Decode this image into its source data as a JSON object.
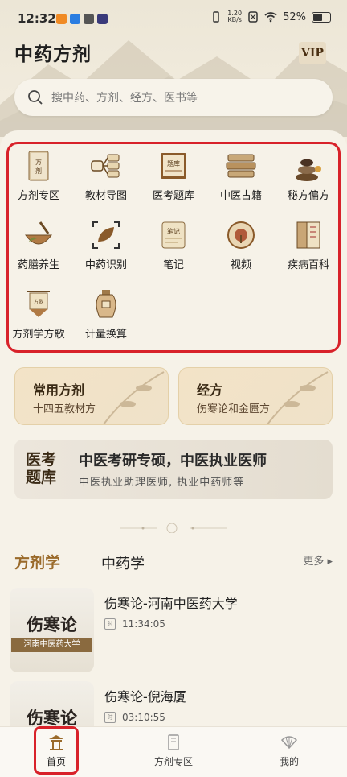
{
  "status_bar": {
    "time": "12:32",
    "net_speed": "1.20",
    "net_unit": "KB/s",
    "battery": "52%"
  },
  "header": {
    "title": "中药方剂",
    "vip_label": "VIP"
  },
  "search": {
    "placeholder": "搜中药、方剂、经方、医书等"
  },
  "grid": {
    "items": [
      {
        "label": "方剂专区",
        "icon": "prescription-book-icon"
      },
      {
        "label": "教材导图",
        "icon": "mind-map-icon"
      },
      {
        "label": "医考题库",
        "icon": "question-bank-icon"
      },
      {
        "label": "中医古籍",
        "icon": "ancient-books-icon"
      },
      {
        "label": "秘方偏方",
        "icon": "stones-icon"
      },
      {
        "label": "药膳养生",
        "icon": "herb-mortar-icon"
      },
      {
        "label": "中药识别",
        "icon": "leaf-scan-icon"
      },
      {
        "label": "笔记",
        "icon": "notes-icon"
      },
      {
        "label": "视频",
        "icon": "video-icon"
      },
      {
        "label": "疾病百科",
        "icon": "encyclopedia-icon"
      },
      {
        "label": "方剂学方歌",
        "icon": "banner-icon"
      },
      {
        "label": "计量换算",
        "icon": "jar-icon"
      }
    ]
  },
  "cards": [
    {
      "title": "常用方剂",
      "subtitle": "十四五教材方"
    },
    {
      "title": "经方",
      "subtitle": "伤寒论和金匮方"
    }
  ],
  "banner": {
    "tag": "医考题库",
    "headline": "中医考研专硕，中医执业医师",
    "sub": "中医执业助理医师, 执业中药师等"
  },
  "section": {
    "tab_active": "方剂学",
    "tab_other": "中药学",
    "more": "更多"
  },
  "list": [
    {
      "thumb_title": "伤寒论",
      "thumb_sub": "河南中医药大学",
      "title": "伤寒论-河南中医药大学",
      "time_label": "时",
      "duration": "11:34:05"
    },
    {
      "thumb_title": "伤寒论",
      "thumb_sub": "",
      "title": "伤寒论-倪海厦",
      "time_label": "时",
      "duration": "03:10:55"
    }
  ],
  "bottom_nav": [
    {
      "label": "首页",
      "icon": "home-pavilion-icon"
    },
    {
      "label": "方剂专区",
      "icon": "book-icon"
    },
    {
      "label": "我的",
      "icon": "fan-icon"
    }
  ],
  "colors": {
    "accent": "#9a6a2a",
    "highlight_border": "#d8222a",
    "background": "#f4efe3"
  }
}
